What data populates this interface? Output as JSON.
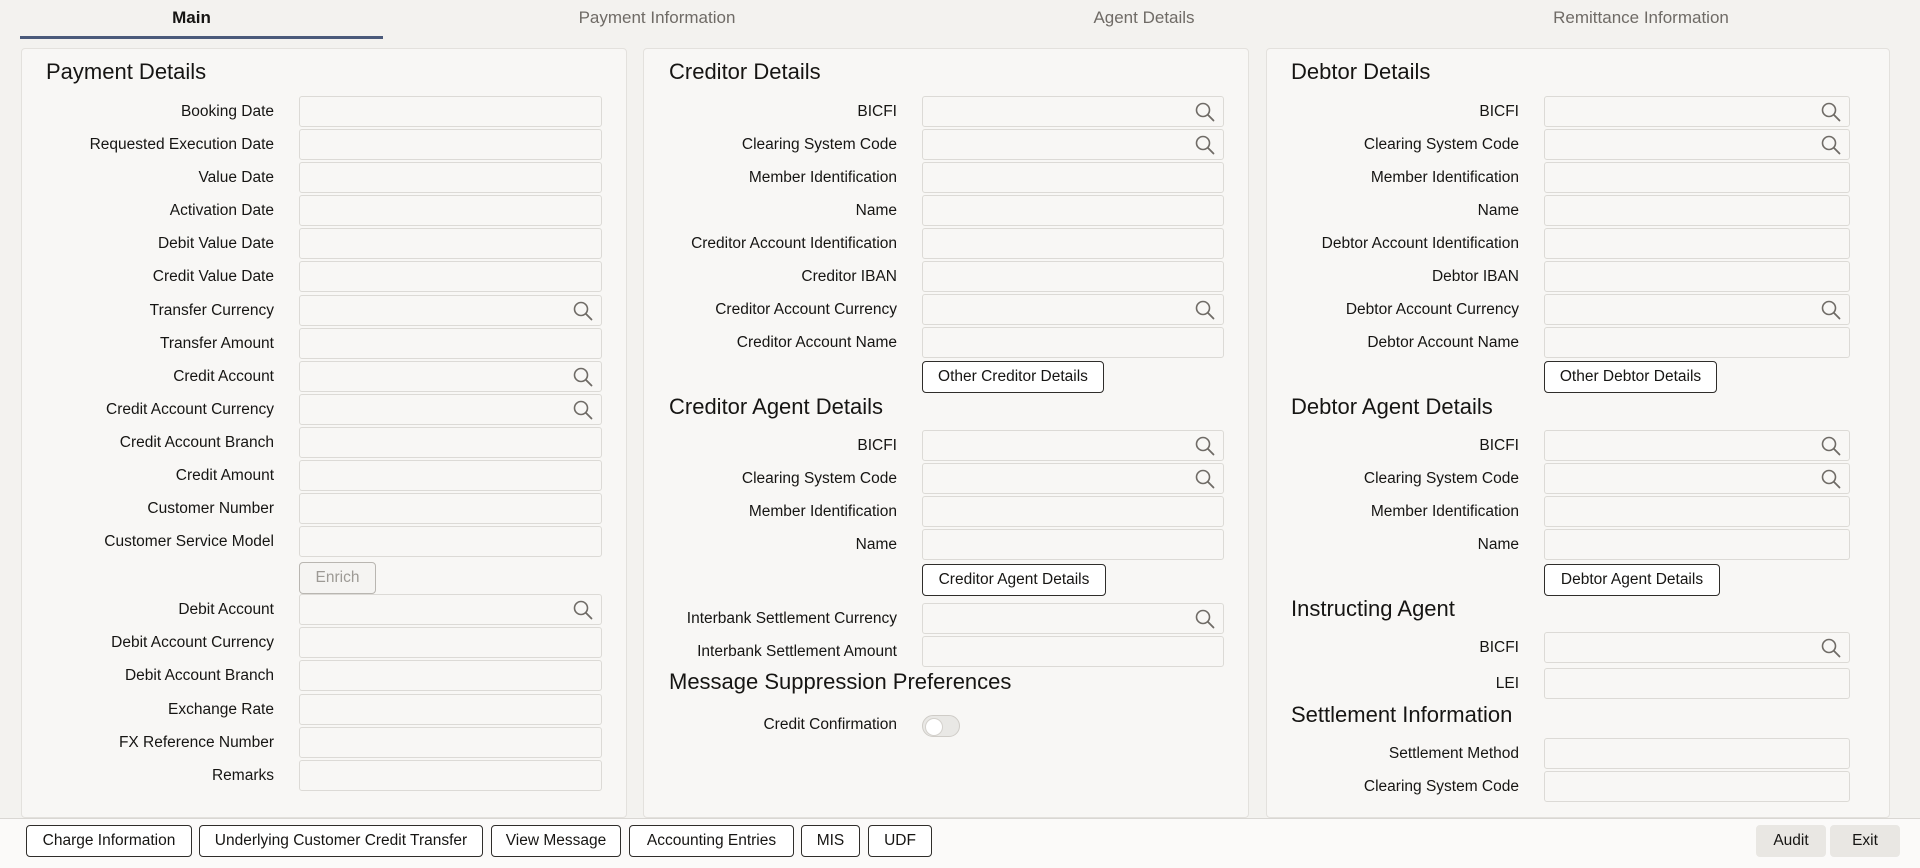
{
  "tabs": [
    "Main",
    "Payment Information",
    "Agent Details",
    "Remittance Information"
  ],
  "payment": {
    "title": "Payment Details",
    "fields": [
      "Booking Date",
      "Requested Execution Date",
      "Value Date",
      "Activation Date",
      "Debit Value Date",
      "Credit Value Date",
      "Transfer Currency",
      "Transfer Amount",
      "Credit Account",
      "Credit Account Currency",
      "Credit Account Branch",
      "Credit Amount",
      "Customer Number",
      "Customer Service Model"
    ],
    "enrich_label": "Enrich",
    "fields2": [
      "Debit Account",
      "Debit Account Currency",
      "Debit Account Branch",
      "Exchange Rate",
      "FX Reference Number",
      "Remarks"
    ]
  },
  "creditor": {
    "title": "Creditor Details",
    "fields": [
      "BICFI",
      "Clearing System Code",
      "Member Identification",
      "Name",
      "Creditor Account Identification",
      "Creditor IBAN",
      "Creditor Account Currency",
      "Creditor Account Name"
    ],
    "other_button": "Other Creditor Details",
    "agent_title": "Creditor Agent Details",
    "agent_fields": [
      "BICFI",
      "Clearing System Code",
      "Member Identification",
      "Name"
    ],
    "agent_button": "Creditor Agent Details",
    "settle_fields": [
      "Interbank Settlement Currency",
      "Interbank Settlement Amount"
    ],
    "msg_title": "Message Suppression Preferences",
    "credit_confirmation": "Credit Confirmation"
  },
  "debtor": {
    "title": "Debtor Details",
    "fields": [
      "BICFI",
      "Clearing System Code",
      "Member Identification",
      "Name",
      "Debtor Account Identification",
      "Debtor IBAN",
      "Debtor Account Currency",
      "Debtor Account Name"
    ],
    "other_button": "Other Debtor Details",
    "agent_title": "Debtor Agent Details",
    "agent_fields": [
      "BICFI",
      "Clearing System Code",
      "Member Identification",
      "Name"
    ],
    "agent_button": "Debtor Agent Details",
    "instructing_title": "Instructing Agent",
    "instructing_fields": [
      "BICFI",
      "LEI"
    ],
    "settlement_title": "Settlement Information",
    "settlement_fields": [
      "Settlement Method",
      "Clearing System Code"
    ]
  },
  "bottom": {
    "buttons": [
      "Charge Information",
      "Underlying Customer Credit Transfer",
      "View Message",
      "Accounting Entries",
      "MIS",
      "UDF"
    ],
    "audit": "Audit",
    "exit": "Exit"
  },
  "icons": {
    "lookup": "search-icon"
  }
}
